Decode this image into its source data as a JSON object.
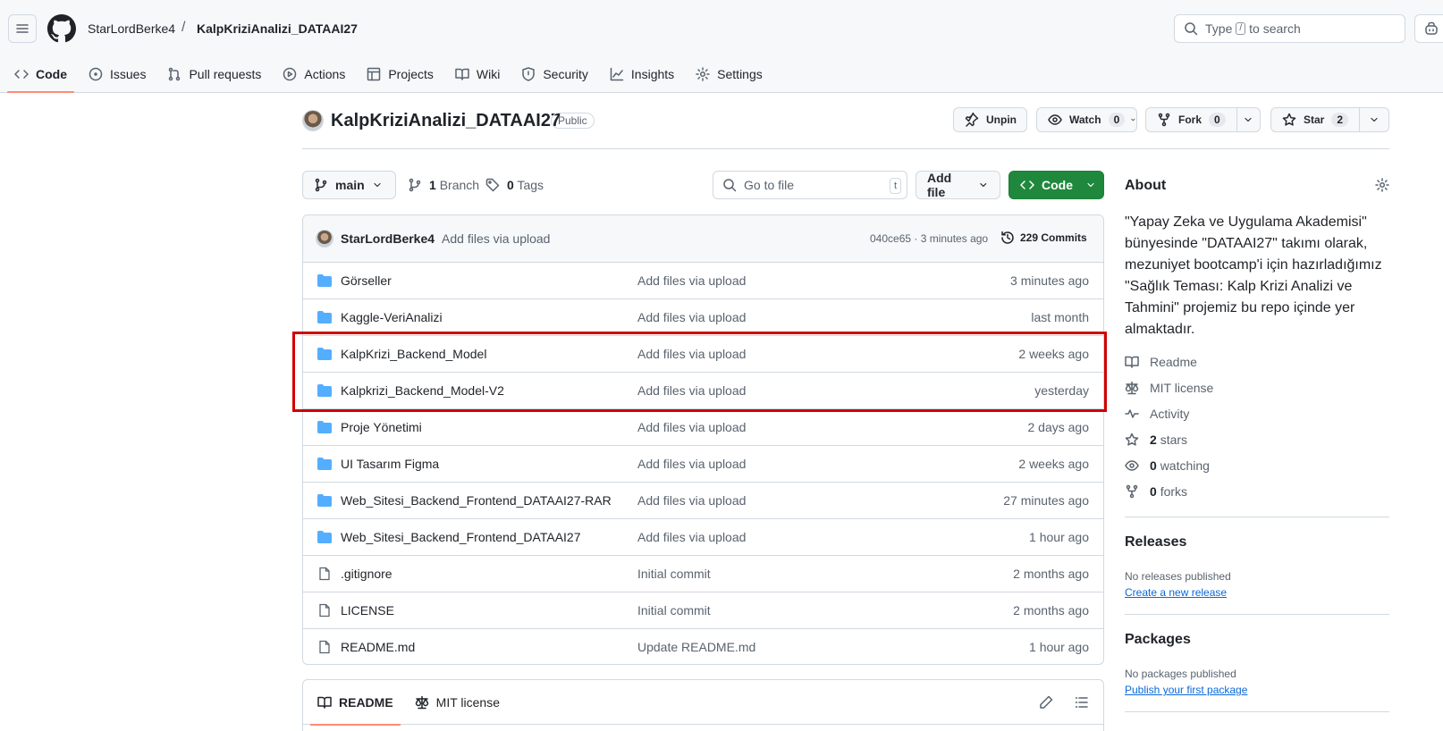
{
  "header": {
    "owner": "StarLordBerke4",
    "separator": "/",
    "repo": "KalpKriziAnalizi_DATAAI27",
    "search_prefix": "Type",
    "search_key": "/",
    "search_suffix": "to search"
  },
  "tabs": [
    {
      "label": "Code",
      "icon": "code-icon"
    },
    {
      "label": "Issues",
      "icon": "issue-icon"
    },
    {
      "label": "Pull requests",
      "icon": "pull-request-icon"
    },
    {
      "label": "Actions",
      "icon": "play-icon"
    },
    {
      "label": "Projects",
      "icon": "table-icon"
    },
    {
      "label": "Wiki",
      "icon": "book-icon"
    },
    {
      "label": "Security",
      "icon": "shield-icon"
    },
    {
      "label": "Insights",
      "icon": "graph-icon"
    },
    {
      "label": "Settings",
      "icon": "gear-icon"
    }
  ],
  "repo_header": {
    "title": "KalpKriziAnalizi_DATAAI27",
    "visibility": "Public",
    "unpin_label": "Unpin",
    "watch_label": "Watch",
    "watch_count": "0",
    "fork_label": "Fork",
    "fork_count": "0",
    "star_label": "Star",
    "star_count": "2"
  },
  "toolbar": {
    "branch": "main",
    "branch_count": "1",
    "branch_label": "Branch",
    "tag_count": "0",
    "tag_label": "Tags",
    "goto_placeholder": "Go to file",
    "goto_key": "t",
    "add_file_label": "Add file",
    "code_label": "Code"
  },
  "latest_commit": {
    "author": "StarLordBerke4",
    "message": "Add files via upload",
    "meta": "040ce65 · 3 minutes ago",
    "commits": "229 Commits"
  },
  "files": [
    {
      "name": "Görseller",
      "type": "dir",
      "message": "Add files via upload",
      "time": "3 minutes ago"
    },
    {
      "name": "Kaggle-VeriAnalizi",
      "type": "dir",
      "message": "Add files via upload",
      "time": "last month"
    },
    {
      "name": "KalpKrizi_Backend_Model",
      "type": "dir",
      "message": "Add files via upload",
      "time": "2 weeks ago"
    },
    {
      "name": "Kalpkrizi_Backend_Model-V2",
      "type": "dir",
      "message": "Add files via upload",
      "time": "yesterday"
    },
    {
      "name": "Proje Yönetimi",
      "type": "dir",
      "message": "Add files via upload",
      "time": "2 days ago"
    },
    {
      "name": "UI Tasarım Figma",
      "type": "dir",
      "message": "Add files via upload",
      "time": "2 weeks ago"
    },
    {
      "name": "Web_Sitesi_Backend_Frontend_DATAAI27-RAR",
      "type": "dir",
      "message": "Add files via upload",
      "time": "27 minutes ago"
    },
    {
      "name": "Web_Sitesi_Backend_Frontend_DATAAI27",
      "type": "dir",
      "message": "Add files via upload",
      "time": "1 hour ago"
    },
    {
      "name": ".gitignore",
      "type": "file",
      "message": "Initial commit",
      "time": "2 months ago"
    },
    {
      "name": "LICENSE",
      "type": "file",
      "message": "Initial commit",
      "time": "2 months ago"
    },
    {
      "name": "README.md",
      "type": "file",
      "message": "Update README.md",
      "time": "1 hour ago"
    }
  ],
  "readme_tabs": {
    "readme": "README",
    "license": "MIT license"
  },
  "about": {
    "title": "About",
    "description": "\"Yapay Zeka ve Uygulama Akademisi\" bünyesinde \"DATAAI27\" takımı olarak, mezuniyet bootcamp'i için hazırladığımız \"Sağlık Teması: Kalp Krizi Analizi ve Tahmini\" projemiz bu repo içinde yer almaktadır.",
    "readme": "Readme",
    "license": "MIT license",
    "activity": "Activity",
    "stars_count": "2",
    "stars_label": "stars",
    "watching_count": "0",
    "watching_label": "watching",
    "forks_count": "0",
    "forks_label": "forks"
  },
  "releases": {
    "title": "Releases",
    "empty": "No releases published",
    "link": "Create a new release"
  },
  "packages": {
    "title": "Packages",
    "empty": "No packages published",
    "link": "Publish your first package"
  },
  "colors": {
    "accent_green": "#1f883d",
    "folder_blue": "#54aeff",
    "highlight_red": "#d00000",
    "tab_underline": "#fd8c73"
  }
}
